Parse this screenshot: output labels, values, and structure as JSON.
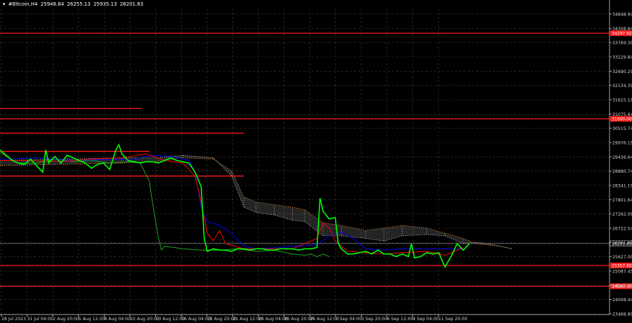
{
  "header": {
    "symbol": "#Bitcoin,H4",
    "open": "25948.84",
    "high": "26255.13",
    "low": "25935.13",
    "close": "26201.83"
  },
  "colors": {
    "background": "#000000",
    "grid": "#3a3a3a",
    "axis": "#cfcfcf",
    "price": "#00ff00",
    "levels": "#ff1a1a",
    "kijun": "#0000ff",
    "tenkan": "#ff0000",
    "chikou": "#1fa31f",
    "cloud": "#cfcfcf",
    "senkou_b": "#ff9933",
    "current_price": "#888888"
  },
  "chart_data": {
    "type": "line",
    "ylim": [
      23468.89,
      35250
    ],
    "y_ticks": [
      "34848.94",
      "34308.84",
      "33769.39",
      "33229.84",
      "32690.29",
      "32134.39",
      "31615.19",
      "31075.64",
      "30515.74",
      "29976.19",
      "29436.64",
      "28880.74",
      "28341.19",
      "27801.64",
      "27262.09",
      "26722.54",
      "26201.83",
      "25627.00",
      "25087.45",
      "24547.90",
      "24008.44",
      "23468.89"
    ],
    "x_ticks": [
      "28 Jul 2023",
      "31 Jul 04:00",
      "2 Aug 20:00",
      "5 Aug 12:00",
      "8 Aug 04:00",
      "10 Aug 20:00",
      "13 Aug 12:00",
      "16 Aug 04:00",
      "18 Aug 20:00",
      "21 Aug 12:00",
      "24 Aug 04:00",
      "26 Aug 20:00",
      "29 Aug 12:00",
      "1 Sep 04:00",
      "3 Sep 20:00",
      "6 Sep 12:00",
      "9 Sep 04:00",
      "11 Sep 20:00"
    ],
    "horizontal_levels": [
      {
        "label": "34297.92",
        "value": 34297.92
      },
      {
        "label": "31000.00",
        "value": 31000.0
      },
      {
        "label": "25357.60",
        "value": 25357.6
      },
      {
        "label": "24560.00",
        "value": 24560.0
      }
    ],
    "short_levels": [
      {
        "value": 31400,
        "end_fraction": 0.233
      },
      {
        "value": 30450,
        "end_fraction": 0.4
      },
      {
        "value": 29750,
        "end_fraction": 0.245
      },
      {
        "value": 28800,
        "end_fraction": 0.4
      }
    ],
    "current_price": 26201.83,
    "price": [
      [
        0.0,
        29800
      ],
      [
        0.01,
        29600
      ],
      [
        0.02,
        29400
      ],
      [
        0.03,
        29300
      ],
      [
        0.04,
        29250
      ],
      [
        0.05,
        29450
      ],
      [
        0.06,
        29200
      ],
      [
        0.07,
        28950
      ],
      [
        0.075,
        29800
      ],
      [
        0.08,
        29300
      ],
      [
        0.09,
        29550
      ],
      [
        0.1,
        29300
      ],
      [
        0.11,
        29600
      ],
      [
        0.12,
        29500
      ],
      [
        0.13,
        29400
      ],
      [
        0.14,
        29300
      ],
      [
        0.15,
        29100
      ],
      [
        0.16,
        29250
      ],
      [
        0.17,
        29300
      ],
      [
        0.18,
        29050
      ],
      [
        0.19,
        29800
      ],
      [
        0.195,
        30000
      ],
      [
        0.2,
        29650
      ],
      [
        0.21,
        29400
      ],
      [
        0.22,
        29350
      ],
      [
        0.23,
        29300
      ],
      [
        0.24,
        29350
      ],
      [
        0.25,
        29350
      ],
      [
        0.26,
        29300
      ],
      [
        0.27,
        29400
      ],
      [
        0.28,
        29500
      ],
      [
        0.29,
        29400
      ],
      [
        0.3,
        29350
      ],
      [
        0.31,
        29300
      ],
      [
        0.32,
        28950
      ],
      [
        0.33,
        28400
      ],
      [
        0.335,
        26400
      ],
      [
        0.34,
        25900
      ],
      [
        0.35,
        26000
      ],
      [
        0.36,
        25950
      ],
      [
        0.37,
        25950
      ],
      [
        0.38,
        25900
      ],
      [
        0.39,
        26000
      ],
      [
        0.4,
        26000
      ],
      [
        0.41,
        25950
      ],
      [
        0.42,
        26000
      ],
      [
        0.43,
        26000
      ],
      [
        0.44,
        25950
      ],
      [
        0.45,
        25950
      ],
      [
        0.46,
        26000
      ],
      [
        0.47,
        26000
      ],
      [
        0.48,
        26000
      ],
      [
        0.49,
        25950
      ],
      [
        0.5,
        26000
      ],
      [
        0.51,
        26000
      ],
      [
        0.52,
        26050
      ],
      [
        0.525,
        27950
      ],
      [
        0.53,
        27450
      ],
      [
        0.54,
        27150
      ],
      [
        0.55,
        27200
      ],
      [
        0.555,
        26200
      ],
      [
        0.56,
        26000
      ],
      [
        0.57,
        25800
      ],
      [
        0.58,
        25800
      ],
      [
        0.59,
        25850
      ],
      [
        0.6,
        25900
      ],
      [
        0.61,
        25800
      ],
      [
        0.62,
        25950
      ],
      [
        0.63,
        25800
      ],
      [
        0.64,
        25800
      ],
      [
        0.65,
        25700
      ],
      [
        0.66,
        25800
      ],
      [
        0.67,
        25700
      ],
      [
        0.675,
        26200
      ],
      [
        0.68,
        25650
      ],
      [
        0.69,
        25700
      ],
      [
        0.7,
        25850
      ],
      [
        0.71,
        25800
      ],
      [
        0.72,
        25850
      ],
      [
        0.73,
        25300
      ],
      [
        0.74,
        25700
      ],
      [
        0.75,
        26200
      ],
      [
        0.76,
        25950
      ],
      [
        0.77,
        26200
      ]
    ],
    "kijun": [
      [
        0.0,
        29450
      ],
      [
        0.06,
        29500
      ],
      [
        0.12,
        29400
      ],
      [
        0.2,
        29450
      ],
      [
        0.21,
        29400
      ],
      [
        0.25,
        29600
      ],
      [
        0.28,
        29550
      ],
      [
        0.31,
        29400
      ],
      [
        0.32,
        28950
      ],
      [
        0.33,
        27600
      ],
      [
        0.34,
        27050
      ],
      [
        0.36,
        26900
      ],
      [
        0.38,
        26600
      ],
      [
        0.4,
        26100
      ],
      [
        0.42,
        26000
      ],
      [
        0.46,
        26050
      ],
      [
        0.48,
        26100
      ],
      [
        0.52,
        26150
      ],
      [
        0.54,
        26500
      ],
      [
        0.56,
        26650
      ],
      [
        0.58,
        26400
      ],
      [
        0.6,
        26000
      ],
      [
        0.63,
        25950
      ],
      [
        0.66,
        26000
      ],
      [
        0.7,
        26000
      ],
      [
        0.73,
        26000
      ],
      [
        0.76,
        26000
      ]
    ],
    "tenkan": [
      [
        0.0,
        29400
      ],
      [
        0.05,
        29400
      ],
      [
        0.1,
        29350
      ],
      [
        0.15,
        29450
      ],
      [
        0.2,
        29500
      ],
      [
        0.24,
        29650
      ],
      [
        0.27,
        29400
      ],
      [
        0.3,
        29300
      ],
      [
        0.32,
        28800
      ],
      [
        0.33,
        27800
      ],
      [
        0.34,
        26600
      ],
      [
        0.35,
        26300
      ],
      [
        0.36,
        26700
      ],
      [
        0.37,
        26200
      ],
      [
        0.4,
        26000
      ],
      [
        0.44,
        26000
      ],
      [
        0.48,
        26000
      ],
      [
        0.52,
        26400
      ],
      [
        0.53,
        27000
      ],
      [
        0.54,
        26800
      ],
      [
        0.55,
        26300
      ],
      [
        0.57,
        25900
      ],
      [
        0.6,
        25850
      ],
      [
        0.63,
        25800
      ],
      [
        0.66,
        25850
      ],
      [
        0.7,
        25900
      ],
      [
        0.73,
        25750
      ],
      [
        0.76,
        26050
      ]
    ],
    "chikou": [
      [
        0.0,
        29700
      ],
      [
        0.03,
        29300
      ],
      [
        0.06,
        29300
      ],
      [
        0.09,
        29450
      ],
      [
        0.12,
        29350
      ],
      [
        0.15,
        29400
      ],
      [
        0.18,
        29300
      ],
      [
        0.21,
        29350
      ],
      [
        0.23,
        29300
      ],
      [
        0.245,
        28600
      ],
      [
        0.25,
        27800
      ],
      [
        0.26,
        26400
      ],
      [
        0.265,
        25950
      ],
      [
        0.27,
        26100
      ],
      [
        0.3,
        26000
      ],
      [
        0.33,
        25950
      ],
      [
        0.36,
        25950
      ],
      [
        0.39,
        26000
      ],
      [
        0.42,
        25900
      ],
      [
        0.45,
        25950
      ],
      [
        0.48,
        25800
      ],
      [
        0.5,
        25750
      ],
      [
        0.51,
        25800
      ],
      [
        0.52,
        25700
      ],
      [
        0.53,
        25800
      ],
      [
        0.54,
        25700
      ]
    ],
    "cloud_a": [
      [
        0.0,
        29400
      ],
      [
        0.1,
        29450
      ],
      [
        0.2,
        29500
      ],
      [
        0.26,
        29500
      ],
      [
        0.3,
        29600
      ],
      [
        0.35,
        29500
      ],
      [
        0.38,
        28800
      ],
      [
        0.4,
        27600
      ],
      [
        0.42,
        27400
      ],
      [
        0.45,
        27300
      ],
      [
        0.48,
        27100
      ],
      [
        0.5,
        27050
      ],
      [
        0.53,
        26500
      ],
      [
        0.56,
        26500
      ],
      [
        0.6,
        26400
      ],
      [
        0.63,
        26300
      ],
      [
        0.66,
        26500
      ],
      [
        0.7,
        26550
      ],
      [
        0.73,
        26500
      ],
      [
        0.76,
        26200
      ],
      [
        0.78,
        26250
      ],
      [
        0.8,
        26200
      ],
      [
        0.82,
        26100
      ],
      [
        0.84,
        26000
      ]
    ],
    "cloud_b": [
      [
        0.0,
        29200
      ],
      [
        0.1,
        29250
      ],
      [
        0.2,
        29300
      ],
      [
        0.26,
        29350
      ],
      [
        0.3,
        29500
      ],
      [
        0.35,
        29450
      ],
      [
        0.38,
        29000
      ],
      [
        0.4,
        28000
      ],
      [
        0.42,
        27800
      ],
      [
        0.45,
        27700
      ],
      [
        0.48,
        27600
      ],
      [
        0.5,
        27500
      ],
      [
        0.53,
        27000
      ],
      [
        0.56,
        26900
      ],
      [
        0.6,
        26700
      ],
      [
        0.63,
        26800
      ],
      [
        0.66,
        26900
      ],
      [
        0.7,
        26800
      ],
      [
        0.73,
        26600
      ],
      [
        0.76,
        26400
      ],
      [
        0.78,
        26200
      ],
      [
        0.8,
        26150
      ],
      [
        0.82,
        26100
      ],
      [
        0.84,
        26000
      ]
    ]
  }
}
